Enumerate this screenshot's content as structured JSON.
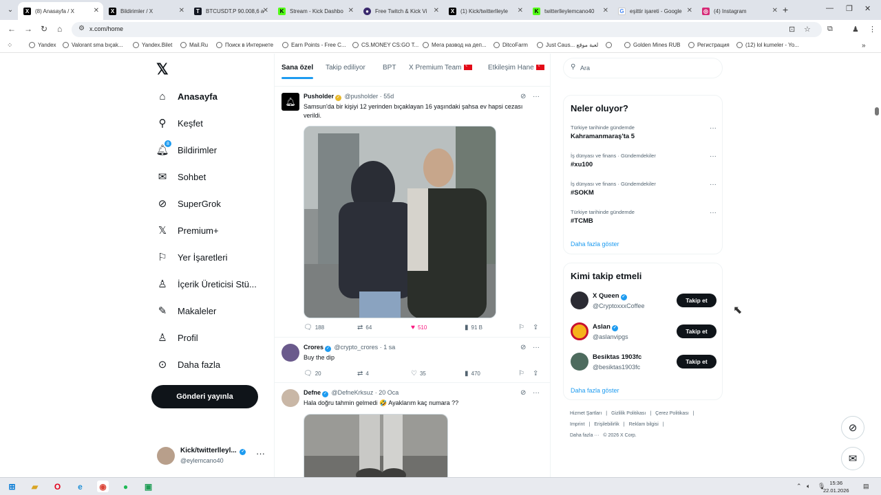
{
  "browser": {
    "tabs": [
      {
        "title": "(8) Anasayfa / X",
        "icon": "x-icon",
        "color": "#000000",
        "active": true
      },
      {
        "title": "Bildirimler / X",
        "icon": "x-icon",
        "color": "#000000"
      },
      {
        "title": "BTCUSDT.P 90.008,6 a",
        "icon": "tradingview-icon",
        "color": "#131722"
      },
      {
        "title": "Stream - Kick Dashbo",
        "icon": "kick-icon",
        "color": "#53fc18"
      },
      {
        "title": "Free Twitch & Kick Vi",
        "icon": "viewer-icon",
        "color": "#3a2a6e"
      },
      {
        "title": "(1) Kick/twitterlleyle",
        "icon": "x-icon",
        "color": "#000000"
      },
      {
        "title": "twitterlleylemcano40",
        "icon": "kick-icon",
        "color": "#53fc18"
      },
      {
        "title": "eşittir işareti - Google",
        "icon": "google-icon",
        "color": "#4285f4"
      },
      {
        "title": "(4) Instagram",
        "icon": "instagram-icon",
        "color": "#d62976"
      }
    ],
    "url": "x.com/home",
    "bookmarks": [
      "Yandex",
      "Valorant sma bıçak...",
      "Yandex.Bilet",
      "Mail.Ru",
      "Поиск в Интернете",
      "Earn Points - Free C...",
      "CS.MONEY CS:GO T...",
      "Мега развод на деп...",
      "DitcoFarm",
      "Just Caus... لعبة موقع",
      "",
      "Golden Mines RUB",
      "Регистрация",
      "(12) lol kumeler - Yo..."
    ]
  },
  "nav": {
    "items": [
      {
        "label": "Anasayfa",
        "icon": "home-icon"
      },
      {
        "label": "Keşfet",
        "icon": "search-icon"
      },
      {
        "label": "Bildirimler",
        "icon": "bell-icon",
        "badge": "8"
      },
      {
        "label": "Sohbet",
        "icon": "mail-icon"
      },
      {
        "label": "SuperGrok",
        "icon": "grok-icon"
      },
      {
        "label": "Premium+",
        "icon": "x-icon"
      },
      {
        "label": "Yer İşaretleri",
        "icon": "bookmark-icon"
      },
      {
        "label": "İçerik Üreticisi Stü...",
        "icon": "creator-studio-icon"
      },
      {
        "label": "Makaleler",
        "icon": "article-icon"
      },
      {
        "label": "Profil",
        "icon": "person-icon"
      },
      {
        "label": "Daha fazla",
        "icon": "more-circle-icon"
      }
    ],
    "post_button": "Gönderi yayınla",
    "account": {
      "name": "Kick/twitterlleyl...",
      "handle": "@eylemcano40"
    }
  },
  "feed_tabs": [
    "Sana özel",
    "Takip ediliyor",
    "BPT",
    "X Premium Team",
    "Etkileşim Hane"
  ],
  "tweets": [
    {
      "name": "Pusholder",
      "handle": "@pusholder",
      "time": "· 55d",
      "text": "Samsun'da bir kişiyi 12 yerinden bıçaklayan 16 yaşındaki şahsa ev hapsi cezası verildi.",
      "replies": "188",
      "retweets": "64",
      "likes": "510",
      "views": "91 B"
    },
    {
      "name": "Crores",
      "handle": "@crypto_crores",
      "time": "· 1 sa",
      "text": "Buy the dip",
      "replies": "20",
      "retweets": "4",
      "likes": "35",
      "views": "470"
    },
    {
      "name": "Defne",
      "handle": "@DefneKrksuz",
      "time": "· 20 Oca",
      "text": "Hala doğru tahmin gelmedi 🤣 Ayaklarım kaç numara ??"
    }
  ],
  "search": {
    "placeholder": "Ara"
  },
  "trends": {
    "title": "Neler oluyor?",
    "items": [
      {
        "context": "Türkiye tarihinde gündemde",
        "topic": "Kahramanmaraş'ta 5"
      },
      {
        "context": "İş dünyası ve finans · Gündemdekiler",
        "topic": "#xu100"
      },
      {
        "context": "İş dünyası ve finans · Gündemdekiler",
        "topic": "#SOKM"
      },
      {
        "context": "Türkiye tarihinde gündemde",
        "topic": "#TCMB"
      }
    ],
    "show_more": "Daha fazla göster"
  },
  "who_to_follow": {
    "title": "Kimi takip etmeli",
    "items": [
      {
        "name": "X Queen",
        "handle": "@CryptoxxxCoffee",
        "button": "Takip et"
      },
      {
        "name": "Aslan",
        "handle": "@aslanvipgs",
        "button": "Takip et"
      },
      {
        "name": "Besiktas 1903fc",
        "handle": "@besiktas1903fc",
        "button": "Takip et"
      }
    ],
    "show_more": "Daha fazla göster"
  },
  "footer": {
    "row1": [
      "Hizmet Şartları",
      "|",
      "Gizlilik Politikası",
      "|",
      "Çerez Politikası",
      "|"
    ],
    "row2": [
      "Imprint",
      "|",
      "Erişilebilirlik",
      "|",
      "Reklam bilgisi",
      "|"
    ],
    "row3": [
      "Daha fazla ···",
      "© 2026 X Corp."
    ]
  },
  "taskbar": {
    "time": "15:36",
    "date": "22.01.2026"
  },
  "colors": {
    "accent": "#1d9bf0",
    "like": "#f91880",
    "text": "#0f1419",
    "muted": "#536471"
  }
}
